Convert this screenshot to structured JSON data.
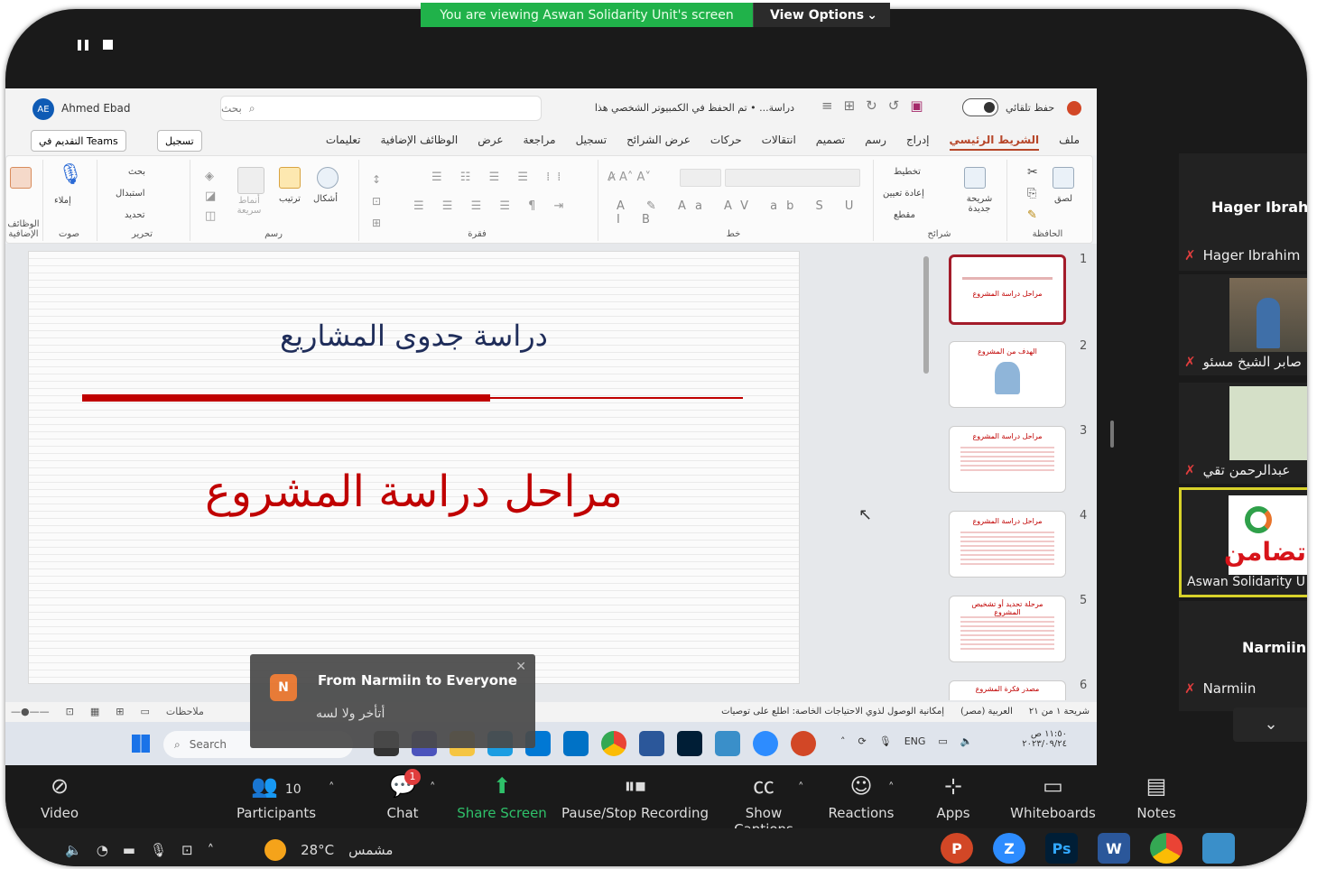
{
  "banner": {
    "viewing_text": "You are viewing Aswan Solidarity Unit's screen",
    "view_options": "View Options"
  },
  "ppt": {
    "user_initials": "AE",
    "user_name": "Ahmed Ebad",
    "search_placeholder": "بحث",
    "doc_title": "دراسة... • تم الحفظ في الكمبيوتر الشخصي هذا",
    "autosave": "حفظ تلقائي",
    "teams_button": "التقديم في Teams",
    "record_button": "تسجيل",
    "tabs": [
      "ملف",
      "الشريط الرئيسي",
      "إدراج",
      "رسم",
      "تصميم",
      "انتقالات",
      "حركات",
      "عرض الشرائح",
      "تسجيل",
      "مراجعة",
      "عرض",
      "الوظائف الإضافية",
      "تعليمات"
    ],
    "ribbon_groups": [
      "الحافظة",
      "شرائح",
      "خط",
      "فقرة",
      "رسم",
      "تحرير",
      "صوت",
      "الوظائف الإضافية"
    ],
    "ribbon_labels": {
      "paste": "لصق",
      "new_slide": "شريحة جديدة",
      "layout": "تخطيط",
      "reset": "إعادة تعيين",
      "section": "مقطع",
      "shapes": "أشكال",
      "arrange": "ترتيب",
      "styles": "أنماط سريعة",
      "find": "بحث",
      "replace": "استبدال",
      "select": "تحديد",
      "dictate": "إملاء"
    },
    "slide_title": "دراسة جدوى المشاريع",
    "slide_subtitle": "مراحل دراسة المشروع",
    "thumb_numbers": [
      "1",
      "2",
      "3",
      "4",
      "5",
      "6"
    ],
    "thumb_texts": [
      "مراحل دراسة المشروع",
      "الهدف من المشروع",
      "مراحل دراسة المشروع",
      "مراحل دراسة المشروع",
      "مرحلة تحديد أو تشخيص المشروع",
      "مصدر فكرة المشروع"
    ],
    "status_slide": "شريحة ١ من ٢١",
    "status_lang": "العربية (مصر)",
    "status_access": "إمكانية الوصول لذوي الاحتياجات الخاصة: اطلع على توصيات",
    "status_notes": "ملاحظات"
  },
  "taskbar_inner": {
    "search": "Search",
    "lang": "ENG",
    "time": "١١:٥٠ ص",
    "date": "٢٠٢٣/٠٩/٢٤"
  },
  "chat": {
    "avatar": "N",
    "from": "From Narmiin to Everyone",
    "message": "أتأخر ولا لسه"
  },
  "participants": [
    {
      "big_name": "Hager Ibrah",
      "name": "Hager Ibrahim"
    },
    {
      "name": "صابر الشيخ مسئو"
    },
    {
      "name": "عبدالرحمن تقي"
    },
    {
      "name": "Aswan Solidarity U"
    },
    {
      "big_name": "Narmiin",
      "name": "Narmiin"
    }
  ],
  "toolbar": {
    "video": "Video",
    "participants": "Participants",
    "participants_count": "10",
    "chat": "Chat",
    "chat_badge": "1",
    "share": "Share Screen",
    "recording": "Pause/Stop Recording",
    "captions": "Show Captions",
    "reactions": "Reactions",
    "apps": "Apps",
    "whiteboards": "Whiteboards",
    "notes": "Notes"
  },
  "os_taskbar": {
    "temperature": "28°C",
    "weather": "مشمس"
  },
  "colors": {
    "banner_green": "#20b24a",
    "slide_red": "#c00000",
    "slide_blue": "#1f2d5a",
    "active_tile": "#d8d22a"
  }
}
